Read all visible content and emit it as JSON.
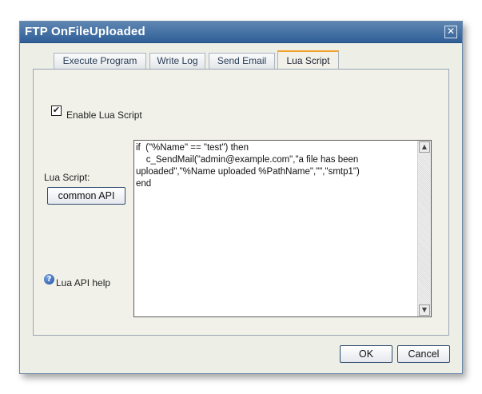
{
  "window": {
    "title": "FTP OnFileUploaded",
    "close_glyph": "✕"
  },
  "tabs": [
    {
      "label": "Execute Program",
      "active": false
    },
    {
      "label": "Write Log",
      "active": false
    },
    {
      "label": "Send Email",
      "active": false
    },
    {
      "label": "Lua Script",
      "active": true
    }
  ],
  "lua": {
    "enable_checked": true,
    "check_glyph": "✔",
    "enable_label": "Enable Lua Script",
    "script_label": "Lua Script:",
    "common_api_label": "common API",
    "help_label": "Lua API help",
    "help_glyph": "?",
    "script": "if  (\"%Name\" == \"test\") then\n    c_SendMail(\"admin@example.com\",\"a file has been uploaded\",\"%Name uploaded %PathName\",\"\",\"smtp1\")\nend"
  },
  "scroll": {
    "up_glyph": "▲",
    "down_glyph": "▼"
  },
  "buttons": {
    "ok_label": "OK",
    "cancel_label": "Cancel"
  },
  "colors": {
    "title_bar": "#3f6da3",
    "active_tab_accent": "#f2a22c",
    "dialog_bg": "#edeee6"
  }
}
